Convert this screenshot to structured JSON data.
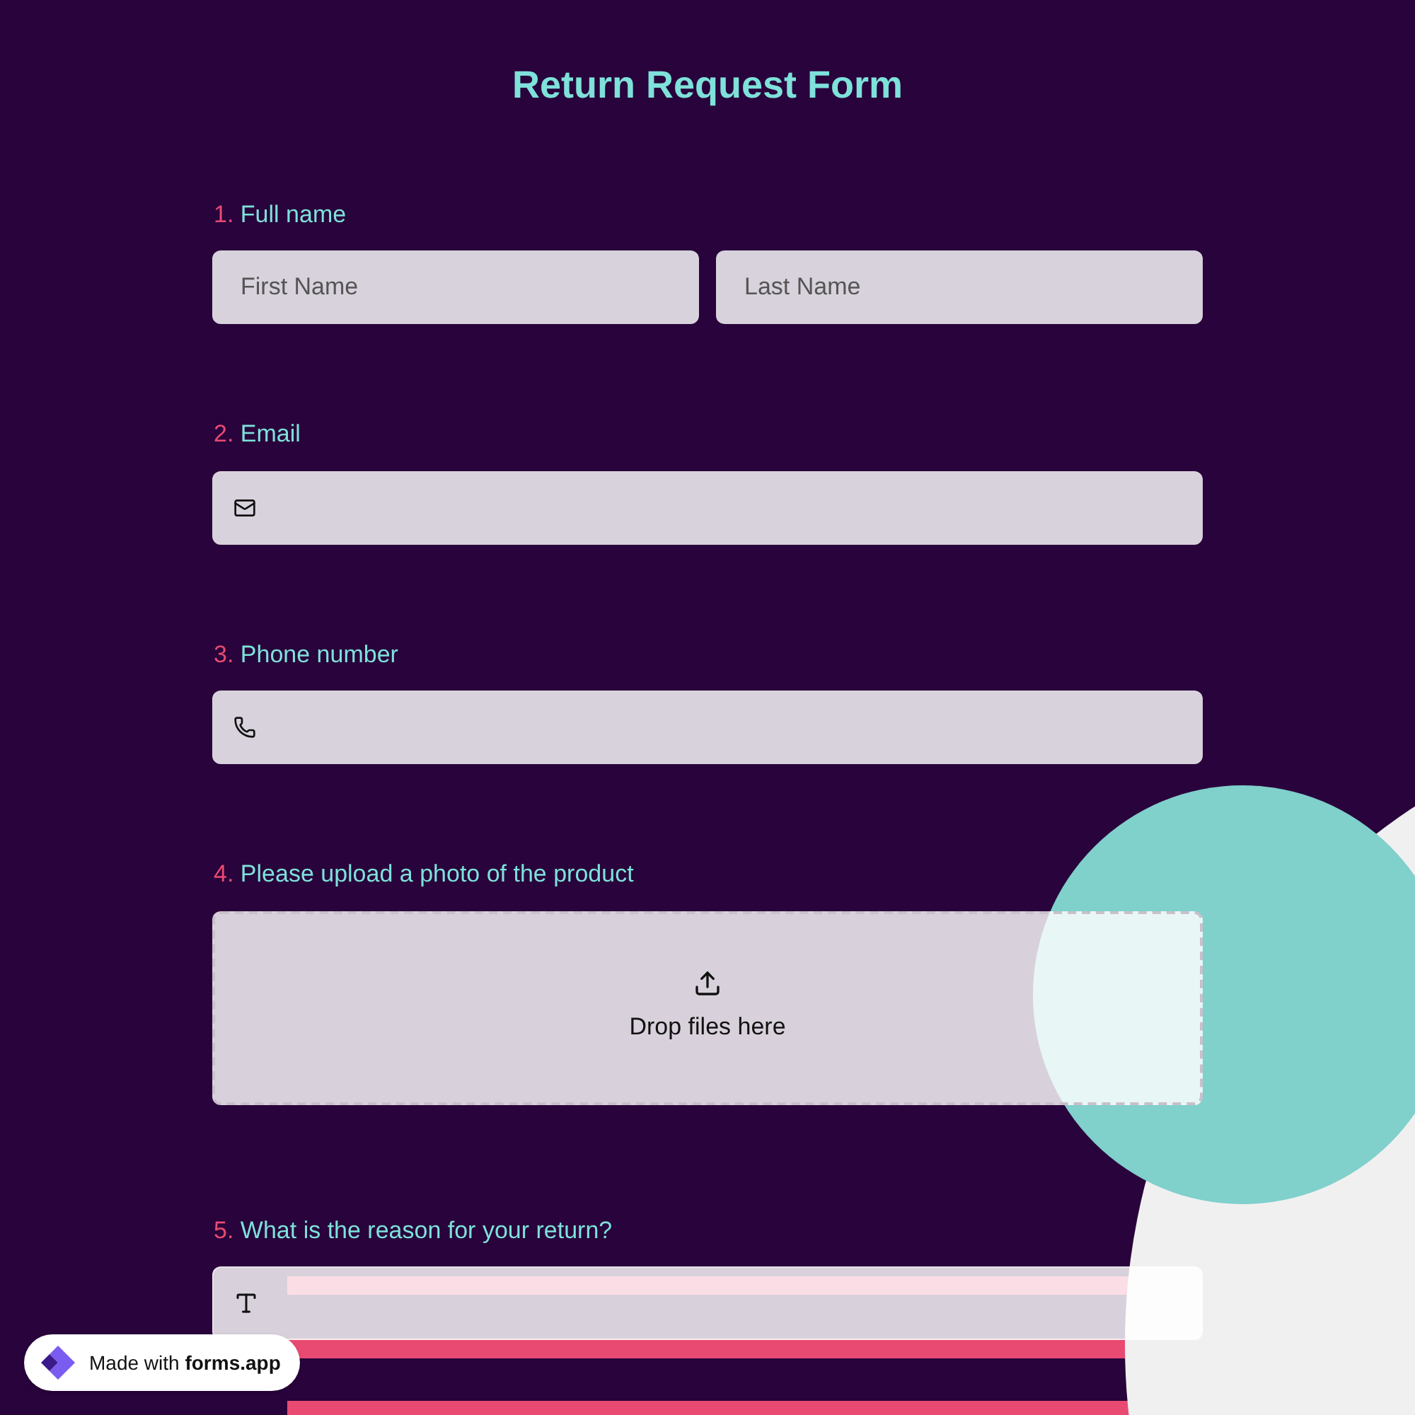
{
  "title": "Return Request Form",
  "questions": [
    {
      "number": "1.",
      "label": "Full name",
      "kind": "name",
      "fields": [
        {
          "placeholder": "First Name"
        },
        {
          "placeholder": "Last Name"
        }
      ]
    },
    {
      "number": "2.",
      "label": "Email",
      "kind": "email"
    },
    {
      "number": "3.",
      "label": "Phone number",
      "kind": "phone"
    },
    {
      "number": "4.",
      "label": "Please upload a photo of the product",
      "kind": "upload",
      "prompt": "Drop files here"
    },
    {
      "number": "5.",
      "label": "What is the reason for your return?",
      "kind": "text"
    }
  ],
  "badge": {
    "prefix": "Made with",
    "brand": "forms.app"
  }
}
